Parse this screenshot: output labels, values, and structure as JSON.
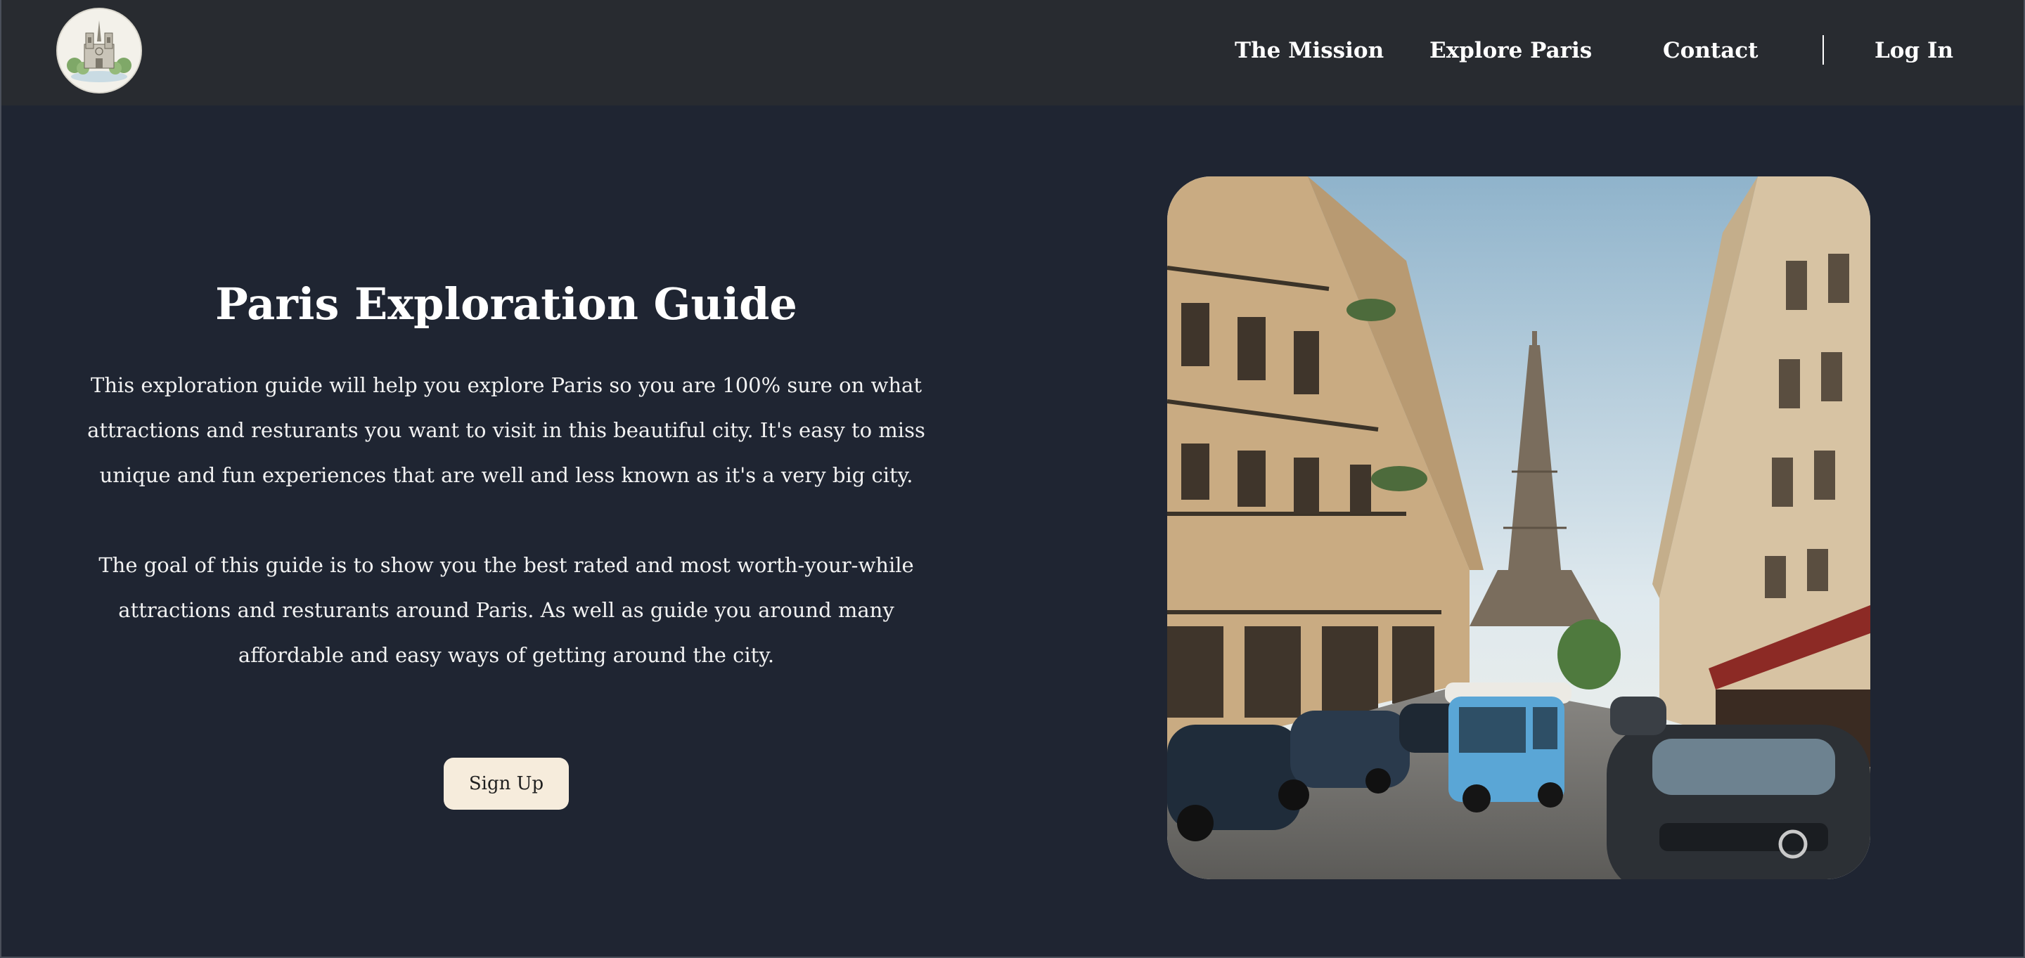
{
  "header": {
    "logo_icon": "notre-dame-illustration-icon",
    "nav": {
      "mission": "The Mission",
      "explore": "Explore Paris",
      "contact": "Contact",
      "login": "Log In"
    }
  },
  "hero": {
    "title": "Paris Exploration Guide",
    "paragraph_1": "This exploration guide will help you explore Paris so you are 100% sure on what attractions and resturants you want to visit in this beautiful city. It's easy to miss unique and fun experiences that are well and less known as it's a very big city.",
    "paragraph_2": "The goal of this guide is to show you the best rated and most worth-your-while attractions and resturants around Paris. As well as guide you around many affordable and easy ways of getting around the city.",
    "signup_label": "Sign Up",
    "image_icon": "paris-street-eiffel-tower-photo"
  },
  "colors": {
    "page_bg": "#1f2532",
    "header_bg": "#282b30",
    "button_bg": "#f6ecdc",
    "text": "#ffffff"
  }
}
